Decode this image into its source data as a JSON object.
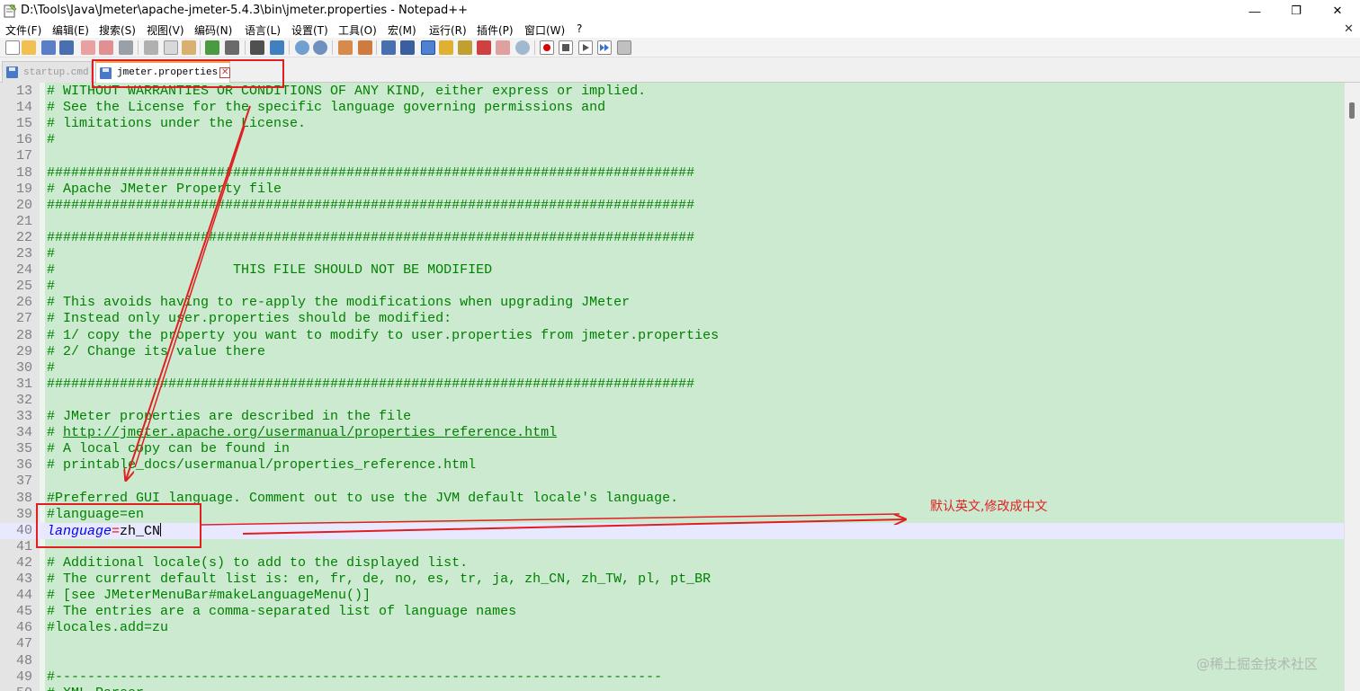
{
  "window": {
    "title": "D:\\Tools\\Java\\Jmeter\\apache-jmeter-5.4.3\\bin\\jmeter.properties - Notepad++",
    "minimize_glyph": "—",
    "maximize_glyph": "❐",
    "close_glyph": "✕"
  },
  "menu": {
    "items": [
      "文件(F)",
      "编辑(E)",
      "搜索(S)",
      "视图(V)",
      "编码(N)",
      "语言(L)",
      "设置(T)",
      "工具(O)",
      "宏(M)",
      "运行(R)",
      "插件(P)",
      "窗口(W)",
      "?"
    ],
    "close_glyph": "✕"
  },
  "toolbar": {
    "icons": [
      "new-file-icon",
      "open-file-icon",
      "save-icon",
      "save-all-icon",
      "close-icon",
      "close-all-icon",
      "print-icon",
      "cut-icon",
      "copy-icon",
      "paste-icon",
      "undo-icon",
      "redo-icon",
      "find-icon",
      "replace-icon",
      "zoom-in-icon",
      "zoom-out-icon",
      "sync-vertical-icon",
      "sync-horizontal-icon",
      "word-wrap-icon",
      "show-all-chars-icon",
      "indent-guide-icon",
      "user-lang-icon",
      "doc-map-icon",
      "function-list-icon",
      "folder-workspace-icon",
      "monitoring-icon",
      "record-macro-icon",
      "stop-macro-icon",
      "play-macro-icon",
      "run-macro-multiple-icon",
      "save-macro-icon"
    ]
  },
  "tabs": [
    {
      "label": "startup.cmd",
      "active": false
    },
    {
      "label": "jmeter.properties",
      "active": true
    }
  ],
  "tab_close_glyph": "✕",
  "editor": {
    "lines": [
      {
        "n": "13",
        "text": "# WITHOUT WARRANTIES OR CONDITIONS OF ANY KIND, either express or implied."
      },
      {
        "n": "14",
        "text": "# See the License for the specific language governing permissions and"
      },
      {
        "n": "15",
        "text": "# limitations under the License."
      },
      {
        "n": "16",
        "text": "#"
      },
      {
        "n": "17",
        "text": ""
      },
      {
        "n": "18",
        "text": "################################################################################"
      },
      {
        "n": "19",
        "text": "# Apache JMeter Property file"
      },
      {
        "n": "20",
        "text": "################################################################################"
      },
      {
        "n": "21",
        "text": ""
      },
      {
        "n": "22",
        "text": "################################################################################"
      },
      {
        "n": "23",
        "text": "#"
      },
      {
        "n": "24",
        "text": "#                      THIS FILE SHOULD NOT BE MODIFIED"
      },
      {
        "n": "25",
        "text": "#"
      },
      {
        "n": "26",
        "text": "# This avoids having to re-apply the modifications when upgrading JMeter"
      },
      {
        "n": "27",
        "text": "# Instead only user.properties should be modified:"
      },
      {
        "n": "28",
        "text": "# 1/ copy the property you want to modify to user.properties from jmeter.properties"
      },
      {
        "n": "29",
        "text": "# 2/ Change its value there"
      },
      {
        "n": "30",
        "text": "#"
      },
      {
        "n": "31",
        "text": "################################################################################"
      },
      {
        "n": "32",
        "text": ""
      },
      {
        "n": "33",
        "text": "# JMeter properties are described in the file"
      },
      {
        "n": "34",
        "text": "# ",
        "link": "http://jmeter.apache.org/usermanual/properties_reference.html"
      },
      {
        "n": "35",
        "text": "# A local copy can be found in"
      },
      {
        "n": "36",
        "text": "# printable_docs/usermanual/properties_reference.html"
      },
      {
        "n": "37",
        "text": ""
      },
      {
        "n": "38",
        "text": "#Preferred GUI language. Comment out to use the JVM default locale's language."
      },
      {
        "n": "39",
        "text": "#language=en"
      },
      {
        "n": "40",
        "key": "language",
        "eq": "=",
        "value": "zh_CN",
        "current": true
      },
      {
        "n": "41",
        "text": ""
      },
      {
        "n": "42",
        "text": "# Additional locale(s) to add to the displayed list."
      },
      {
        "n": "43",
        "text": "# The current default list is: en, fr, de, no, es, tr, ja, zh_CN, zh_TW, pl, pt_BR"
      },
      {
        "n": "44",
        "text": "# [see JMeterMenuBar#makeLanguageMenu()]"
      },
      {
        "n": "45",
        "text": "# The entries are a comma-separated list of language names"
      },
      {
        "n": "46",
        "text": "#locales.add=zu"
      },
      {
        "n": "47",
        "text": ""
      },
      {
        "n": "48",
        "text": ""
      },
      {
        "n": "49",
        "text": "#---------------------------------------------------------------------------"
      },
      {
        "n": "50",
        "text": "# XML Parser"
      }
    ]
  },
  "annotation": {
    "note": "默认英文,修改成中文",
    "color": "#e02020"
  },
  "watermark": "@稀土掘金技术社区",
  "colors": {
    "editor_bg": "#ccead0",
    "comment": "#008000",
    "keyword": "#0000ff",
    "operator": "#ff0000",
    "current_line": "#e8e8ff"
  }
}
